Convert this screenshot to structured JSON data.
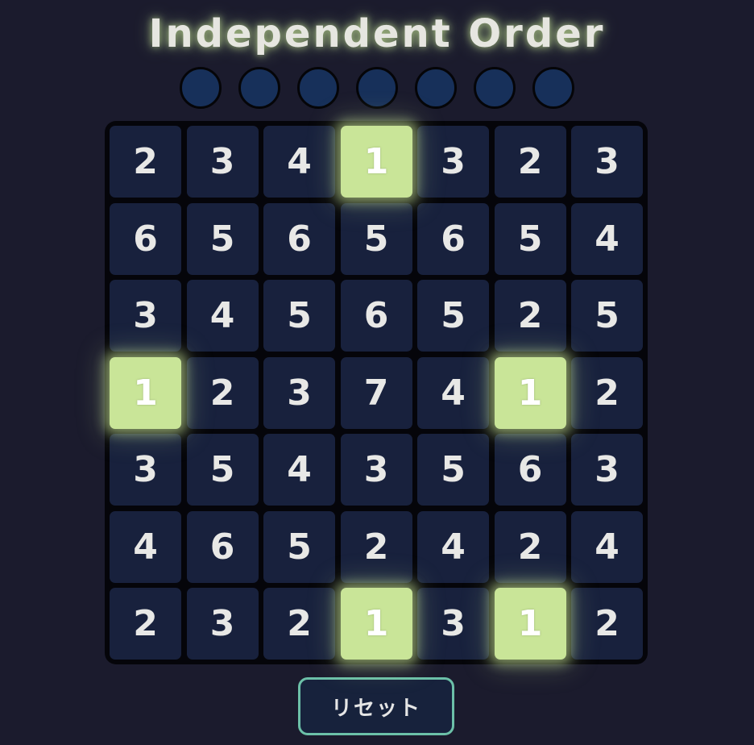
{
  "title": "Independent Order",
  "indicators": [
    {
      "state": "off"
    },
    {
      "state": "off"
    },
    {
      "state": "off"
    },
    {
      "state": "off"
    },
    {
      "state": "off"
    },
    {
      "state": "off"
    },
    {
      "state": "off"
    }
  ],
  "grid": [
    [
      "2",
      "3",
      "4",
      "1",
      "3",
      "2",
      "3"
    ],
    [
      "6",
      "5",
      "6",
      "5",
      "6",
      "5",
      "4"
    ],
    [
      "3",
      "4",
      "5",
      "6",
      "5",
      "2",
      "5"
    ],
    [
      "1",
      "2",
      "3",
      "7",
      "4",
      "1",
      "2"
    ],
    [
      "3",
      "5",
      "4",
      "3",
      "5",
      "6",
      "3"
    ],
    [
      "4",
      "6",
      "5",
      "2",
      "4",
      "2",
      "4"
    ],
    [
      "2",
      "3",
      "2",
      "1",
      "3",
      "1",
      "2"
    ]
  ],
  "highlighted": [
    [
      0,
      3
    ],
    [
      3,
      0
    ],
    [
      3,
      5
    ],
    [
      6,
      3
    ],
    [
      6,
      5
    ]
  ],
  "reset_label": "リセット",
  "colors": {
    "background": "#1b1b2d",
    "cell": "#18213d",
    "cell_highlight": "#c9e598",
    "indicator_off": "#17305a",
    "reset_border": "#6cc0a8"
  }
}
